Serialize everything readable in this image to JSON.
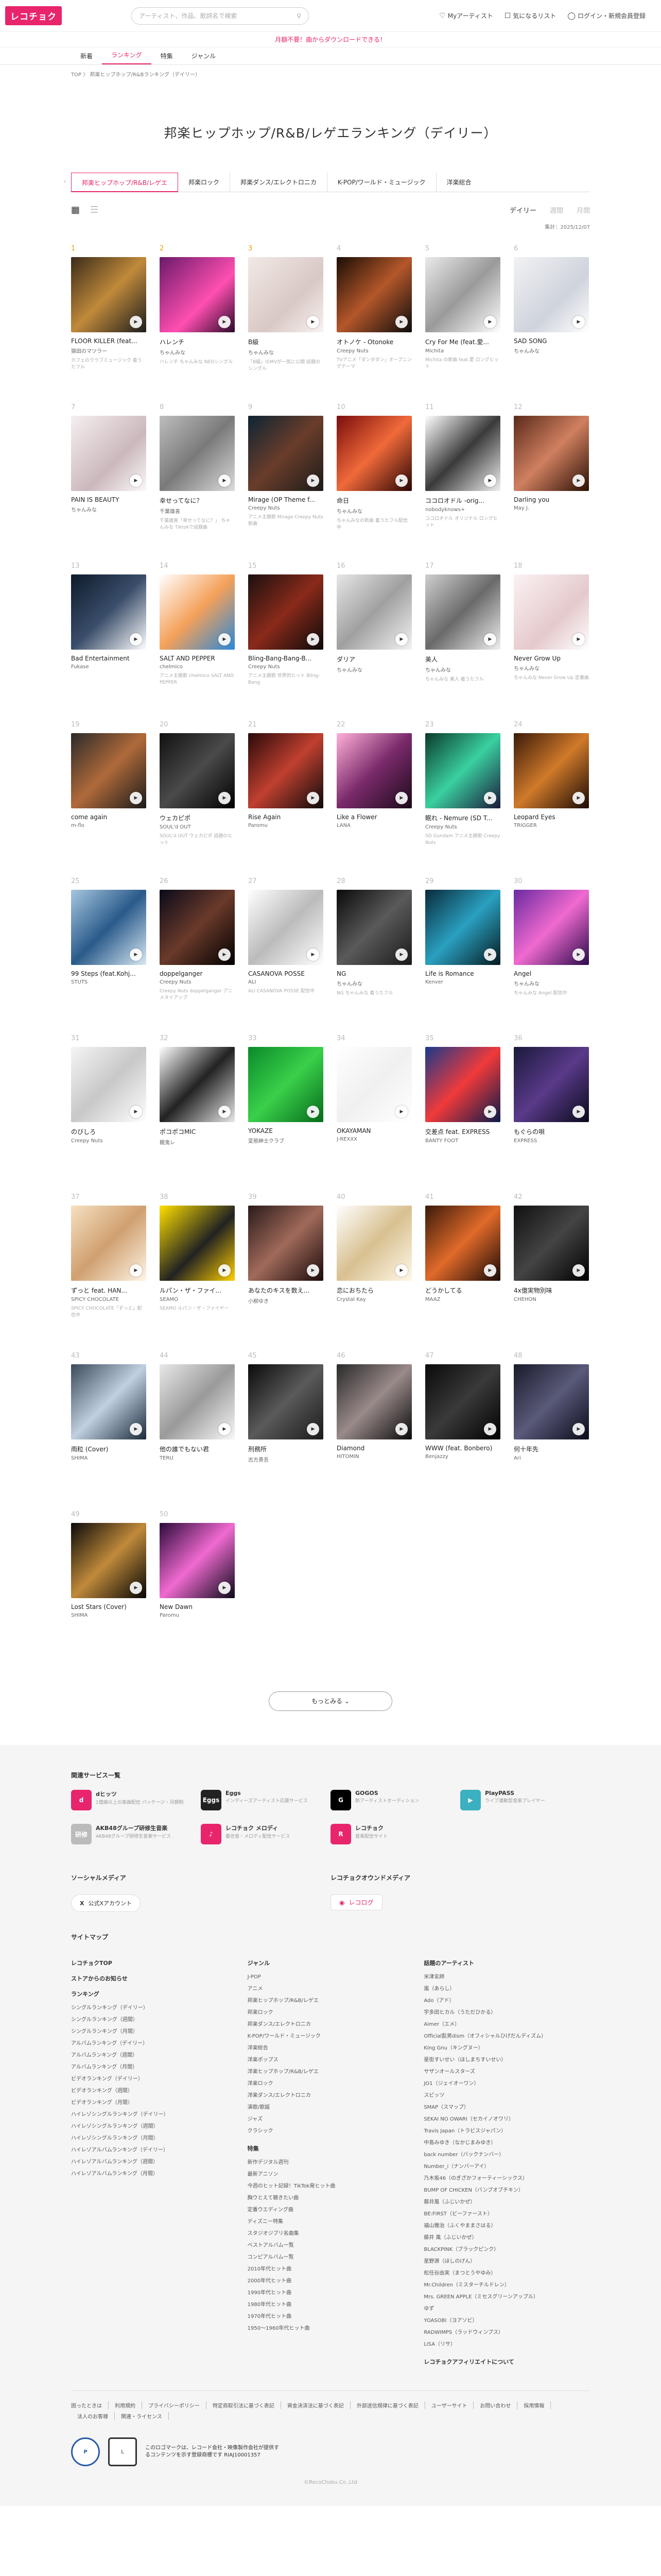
{
  "header": {
    "logo": "レコチョク",
    "search_placeholder": "アーティスト、作品、歌詞名で検索",
    "my_artist": "Myアーティスト",
    "favorites": "気になるリスト",
    "login": "ログイン・新規会員登録"
  },
  "promo": "月額不要！曲からダウンロードできる！",
  "nav": [
    "新着",
    "ランキング",
    "特集",
    "ジャンル"
  ],
  "breadcrumb": "TOP 〉 邦楽ヒップホップ/R&Bランキング（デイリー）",
  "page_title": "邦楽ヒップホップ/R&B/レゲエランキング（デイリー）",
  "tabs": [
    "邦楽ヒップホップ/R&B/レゲエ",
    "邦楽ロック",
    "邦楽ダンス/エレクトロニカ",
    "K-POP/ワールド・ミュージック",
    "洋楽総合"
  ],
  "period": {
    "daily": "デイリー",
    "weekly": "週間",
    "monthly": "月間"
  },
  "aggregation": "集計：2025/12/07",
  "items": [
    {
      "rank": "1",
      "title": "FLOOR KILLER (feat...",
      "artist": "猿田のマツラー",
      "desc": "カフェのクラブミュージック 着うたフル",
      "bg": "linear-gradient(135deg,#3a2b1a,#c08a3a 50%,#1d1d1d)"
    },
    {
      "rank": "2",
      "title": "ハレンチ",
      "artist": "ちゃんみな",
      "desc": "ハレンチ ちゃんみな  NEOシングル",
      "bg": "linear-gradient(135deg,#6a1a6a,#ff4fb0 60%,#2a0b2a)"
    },
    {
      "rank": "3",
      "title": "B級",
      "artist": "ちゃんみな",
      "desc": "「B級」のMVが一気に公開 話題のシングル",
      "bg": "linear-gradient(135deg,#f1e9e6,#d9c8c5 60%,#f8f3f1)"
    },
    {
      "rank": "4",
      "title": "オトノケ - Otonoke",
      "artist": "Creepy Nuts",
      "desc": "TVアニメ「ダンダダン」オープニングテーマ",
      "bg": "linear-gradient(135deg,#1a0d05,#b4572a 50%,#0c0c0c)"
    },
    {
      "rank": "5",
      "title": "Cry For Me (feat.愛...",
      "artist": "Michita",
      "desc": "Michita の新曲 feat.愛 ロングヒット",
      "bg": "linear-gradient(135deg,#eaeaea,#9a9a9a 50%,#ffffff)"
    },
    {
      "rank": "6",
      "title": "SAD SONG",
      "artist": "ちゃんみな",
      "desc": "",
      "bg": "linear-gradient(135deg,#f2f2f4,#cfd3dc 60%,#ffffff)"
    },
    {
      "rank": "7",
      "title": "PAIN IS BEAUTY",
      "artist": "ちゃんみな",
      "desc": "",
      "bg": "linear-gradient(135deg,#f5eff0,#cbb8bc 60%,#fbf9fa)"
    },
    {
      "rank": "8",
      "title": "幸せってなに？",
      "artist": "千葉雄喜",
      "desc": "千葉雄喜「幸せってなに？」 ちゃんみな Tiktokで話題曲",
      "bg": "linear-gradient(135deg,#bdbdbd,#7a7a7a 50%,#dcdcdc)"
    },
    {
      "rank": "9",
      "title": "Mirage (OP Theme f...",
      "artist": "Creepy Nuts",
      "desc": "アニメ主題歌 Mirage Creepy Nuts 新曲",
      "bg": "linear-gradient(135deg,#0e2433,#6a3d2a 50%,#1b1b1b)"
    },
    {
      "rank": "10",
      "title": "命日",
      "artist": "ちゃんみな",
      "desc": "ちゃんみなの新曲 着うたフル配信中",
      "bg": "linear-gradient(135deg,#7a0d0d,#f06a3a 50%,#2a0505)"
    },
    {
      "rank": "11",
      "title": "ココロオドル -orig...",
      "artist": "nobodyknows+",
      "desc": "ココロオドル オリジナル ロングヒット",
      "bg": "linear-gradient(135deg,#ffffff,#3a3a3a 50%,#f0f0f0)"
    },
    {
      "rank": "12",
      "title": "Darling you",
      "artist": "May J.",
      "desc": "",
      "bg": "linear-gradient(135deg,#5a2a1a,#d08060 50%,#2a1005)"
    },
    {
      "rank": "13",
      "title": "Bad Entertainment",
      "artist": "Fukase",
      "desc": "",
      "bg": "linear-gradient(135deg,#0d1b2a,#3a4d6a 50%,#ffffff)"
    },
    {
      "rank": "14",
      "title": "SALT AND PEPPER",
      "artist": "chelmico",
      "desc": "アニメ主題歌 chelmico SALT AND PEPPER",
      "bg": "linear-gradient(135deg,#ffffff,#f4a15a 50%,#2a88d8)"
    },
    {
      "rank": "15",
      "title": "Bling-Bang-Bang-B...",
      "artist": "Creepy Nuts",
      "desc": "アニメ主題歌 世界的ヒット Bling-Bang",
      "bg": "linear-gradient(135deg,#1a1010,#8a2a1a 50%,#0a0a0a)"
    },
    {
      "rank": "16",
      "title": "ダリア",
      "artist": "ちゃんみな",
      "desc": "",
      "bg": "linear-gradient(135deg,#e6e6e6,#a0a0a0 50%,#f3f3f3)"
    },
    {
      "rank": "17",
      "title": "美人",
      "artist": "ちゃんみな",
      "desc": "ちゃんみな 美人 着うたフル",
      "bg": "linear-gradient(135deg,#cfcfcf,#6a6a6a 50%,#efefef)"
    },
    {
      "rank": "18",
      "title": "Never Grow Up",
      "artist": "ちゃんみな",
      "desc": "ちゃんみな Never Grow Up 定番曲",
      "bg": "linear-gradient(135deg,#fbf2f3,#e4c9cc 60%,#ffffff)"
    },
    {
      "rank": "19",
      "title": "come again",
      "artist": "m-flo",
      "desc": "",
      "bg": "linear-gradient(135deg,#2a2a2a,#b06a3a 50%,#1a1a1a)"
    },
    {
      "rank": "20",
      "title": "ウェカピポ",
      "artist": "SOUL'd OUT",
      "desc": "SOUL'd OUT ウェカピポ 話題のヒット",
      "bg": "linear-gradient(135deg,#111,#4a4a4a 50%,#000)"
    },
    {
      "rank": "21",
      "title": "Rise Again",
      "artist": "Paromu",
      "desc": "",
      "bg": "linear-gradient(135deg,#2a0a0a,#c04030 50%,#0a0a0a)"
    },
    {
      "rank": "22",
      "title": "Like a Flower",
      "artist": "LANA",
      "desc": "",
      "bg": "linear-gradient(135deg,#ffb0d8,#7a2a6a 50%,#1a0a1a)"
    },
    {
      "rank": "23",
      "title": "眠れ - Nemure (SD T...",
      "artist": "Creepy Nuts",
      "desc": "SD Gundam アニメ主題歌 Creepy Nuts",
      "bg": "linear-gradient(135deg,#0a3a2a,#3ad0a0 50%,#1a1a3a)"
    },
    {
      "rank": "24",
      "title": "Leopard Eyes",
      "artist": "TRIGGER",
      "desc": "",
      "bg": "linear-gradient(135deg,#3a1a0a,#d07a2a 50%,#1a0a05)"
    },
    {
      "rank": "25",
      "title": "99 Steps (feat.Kohj...",
      "artist": "STUTS",
      "desc": "",
      "bg": "linear-gradient(135deg,#a7c7e0,#2a5a8a 50%,#d8e8f3)"
    },
    {
      "rank": "26",
      "title": "doppelganger",
      "artist": "Creepy Nuts",
      "desc": "Creepy Nuts doppelganger アニメタイアップ",
      "bg": "linear-gradient(135deg,#0a0a1a,#6a3a2a 50%,#000)"
    },
    {
      "rank": "27",
      "title": "CASANOVA POSSE",
      "artist": "ALI",
      "desc": "ALI CASANOVA POSSE 配信中",
      "bg": "linear-gradient(135deg,#ffffff,#bbbbbb 50%,#ffffff)"
    },
    {
      "rank": "28",
      "title": "NG",
      "artist": "ちゃんみな",
      "desc": "NG ちゃんみな 着うたフル",
      "bg": "linear-gradient(135deg,#0a0a0a,#5a5a5a 50%,#1a1a1a)"
    },
    {
      "rank": "29",
      "title": "Life is Romance",
      "artist": "Kenver",
      "desc": "",
      "bg": "linear-gradient(135deg,#0a2a3a,#2aa0c0 50%,#051a20)"
    },
    {
      "rank": "30",
      "title": "Angel",
      "artist": "ちゃんみな",
      "desc": "ちゃんみな Angel 配信中",
      "bg": "linear-gradient(135deg,#6a2aa0,#f06ad0 50%,#2a0a4a)"
    },
    {
      "rank": "31",
      "title": "のびしろ",
      "artist": "Creepy Nuts",
      "desc": "",
      "bg": "linear-gradient(135deg,#f5f5f5,#c8c8c8 50%,#ffffff)"
    },
    {
      "rank": "32",
      "title": "ポコポコMIC",
      "artist": "餓鬼レ",
      "desc": "",
      "bg": "linear-gradient(135deg,#ffffff,#222 50%,#e8e8e8)"
    },
    {
      "rank": "33",
      "title": "YOKAZE",
      "artist": "変態紳士クラブ",
      "desc": "",
      "bg": "linear-gradient(135deg,#0a8a2a,#3ad04a 50%,#066a1a)"
    },
    {
      "rank": "34",
      "title": "OKAYAMAN",
      "artist": "J-REXXX",
      "desc": "",
      "bg": "linear-gradient(135deg,#ffffff,#f0f0f0 50%,#ffffff)"
    },
    {
      "rank": "35",
      "title": "交差点 feat. EXPRESS",
      "artist": "BANTY FOOT",
      "desc": "",
      "bg": "linear-gradient(135deg,#1a3a8a,#f03a3a 50%,#0a1a4a)"
    },
    {
      "rank": "36",
      "title": "もぐらの唄",
      "artist": "EXPRESS",
      "desc": "",
      "bg": "linear-gradient(135deg,#1a1a3a,#5a3a8a 50%,#0a0a1a)"
    },
    {
      "rank": "37",
      "title": "ずっと feat. HAN...",
      "artist": "SPICY CHOCOLATE",
      "desc": "SPICY CHOCOLATE「ずっと」配信中",
      "bg": "linear-gradient(135deg,#f5e0c0,#d0a070 50%,#fff5e6)"
    },
    {
      "rank": "38",
      "title": "ルパン・ザ・ファイ...",
      "artist": "SEAMO",
      "desc": "SEAMO ルパン・ザ・ファイヤー",
      "bg": "linear-gradient(135deg,#ffe000,#222 55%,#ffd000)"
    },
    {
      "rank": "39",
      "title": "あなたのキスを数え...",
      "artist": "小柳ゆき",
      "desc": "",
      "bg": "linear-gradient(135deg,#2a1a1a,#a06a5a 50%,#1a0a0a)"
    },
    {
      "rank": "40",
      "title": "恋におちたら",
      "artist": "Crystal Kay",
      "desc": "",
      "bg": "linear-gradient(135deg,#ffffff,#d8c090 50%,#fff8e8)"
    },
    {
      "rank": "41",
      "title": "どうかしてる",
      "artist": "MAAZ",
      "desc": "",
      "bg": "linear-gradient(135deg,#3a1a0a,#e06a2a 50%,#1a0a05)"
    },
    {
      "rank": "42",
      "title": "4x億実物別味",
      "artist": "CHEHON",
      "desc": "",
      "bg": "linear-gradient(135deg,#111,#444 50%,#000)"
    },
    {
      "rank": "43",
      "title": "雨粒 (Cover)",
      "artist": "SHIMA",
      "desc": "",
      "bg": "linear-gradient(135deg,#3a4a5a,#c0d0e0 50%,#1a2a3a)"
    },
    {
      "rank": "44",
      "title": "他の誰でもない君",
      "artist": "TERU",
      "desc": "",
      "bg": "linear-gradient(135deg,#e8e8e8,#9a9a9a 50%,#f8f8f8)"
    },
    {
      "rank": "45",
      "title": "刑務所",
      "artist": "志方勇吾",
      "desc": "",
      "bg": "linear-gradient(135deg,#0a0a0a,#5a5a5a 50%,#1a1a1a)"
    },
    {
      "rank": "46",
      "title": "Diamond",
      "artist": "HITOMIN",
      "desc": "",
      "bg": "linear-gradient(135deg,#2a2a2a,#9a8a8a 50%,#0a0a0a)"
    },
    {
      "rank": "47",
      "title": "WWW (feat. Bonbero)",
      "artist": "Benjazzy",
      "desc": "",
      "bg": "linear-gradient(135deg,#0a0a0a,#3a3a3a 50%,#000)"
    },
    {
      "rank": "48",
      "title": "何十年先",
      "artist": "Ari",
      "desc": "",
      "bg": "linear-gradient(135deg,#1a1a2a,#5a5a7a 50%,#0a0a1a)"
    },
    {
      "rank": "49",
      "title": "Lost Stars (Cover)",
      "artist": "SHIMA",
      "desc": "",
      "bg": "linear-gradient(135deg,#0a0a0a,#c08a3a 50%,#050505)"
    },
    {
      "rank": "50",
      "title": "New Dawn",
      "artist": "Paromu",
      "desc": "",
      "bg": "linear-gradient(135deg,#2a0a3a,#f06ad0 50%,#0a0a1a)"
    }
  ],
  "more_button": "もっとみる",
  "footer": {
    "services_title": "関連サービス一覧",
    "services": [
      {
        "name": "dヒッツ",
        "desc": "1億曲以上の楽曲配信 パッケージ・月額制",
        "color": "#e8256c",
        "mark": "d"
      },
      {
        "name": "Eggs",
        "desc": "インディーズアーティスト応援サービス",
        "color": "#222222",
        "mark": "Eggs"
      },
      {
        "name": "GOGOS",
        "desc": "新アーティストオーディション",
        "color": "#000000",
        "mark": "G"
      },
      {
        "name": "PlayPASS",
        "desc": "ライブ連動型音楽プレイヤー",
        "color": "#3ab0c0",
        "mark": "▶"
      },
      {
        "name": "AKB48グループ研修生音楽",
        "desc": "AKB48グループ研修生音楽サービス",
        "color": "#bbbbbb",
        "mark": "研修"
      },
      {
        "name": "レコチョク メロディ",
        "desc": "着信音・メロディ配信サービス",
        "color": "#e8256c",
        "mark": "♪"
      },
      {
        "name": "レコチョク",
        "desc": "音楽配信サイト",
        "color": "#e8256c",
        "mark": "R"
      }
    ],
    "social_title": "ソーシャルメディア",
    "x_account": "公式Xアカウント",
    "owned_title": "レコチョクオウンドメディア",
    "owned_name": "レコログ",
    "sitemap_title": "サイトマップ",
    "col1": {
      "head1": "レコチョクTOP",
      "head2": "ストアからのお知らせ",
      "head3": "ランキング",
      "links": [
        "シングルランキング（デイリー）",
        "シングルランキング（週間）",
        "シングルランキング（月間）",
        "アルバムランキング（デイリー）",
        "アルバムランキング（週間）",
        "アルバムランキング（月間）",
        "ビデオランキング（デイリー）",
        "ビデオランキング（週間）",
        "ビデオランキング（月間）",
        "ハイレゾシングルランキング（デイリー）",
        "ハイレゾシングルランキング（週間）",
        "ハイレゾシングルランキング（月間）",
        "ハイレゾアルバムランキング（デイリー）",
        "ハイレゾアルバムランキング（週間）",
        "ハイレゾアルバムランキング（月間）"
      ]
    },
    "col2": {
      "head1": "ジャンル",
      "links1": [
        "J-POP",
        "アニメ",
        "邦楽ヒップホップ/R&B/レゲエ",
        "邦楽ロック",
        "邦楽ダンス/エレクトロニカ",
        "K-POP/ワールド・ミュージック",
        "洋楽総合",
        "洋楽ポップス",
        "洋楽ヒップホップ/R&B/レゲエ",
        "洋楽ロック",
        "洋楽ダンス/エレクトロニカ",
        "演歌/歌謡",
        "ジャズ",
        "クラシック"
      ],
      "head2": "特集",
      "links2": [
        "新作デジタル週刊",
        "最新アニソン",
        "今週のヒット記録！TikTok発ヒット曲",
        "胸ウとえて聴きたい曲",
        "定番ウエディング曲",
        "ディズニー特集",
        "スタジオジブリ名曲集",
        "ベストアルバム一覧",
        "コンピアルバム一覧",
        "2010年代ヒット曲",
        "2000年代ヒット曲",
        "1990年代ヒット曲",
        "1980年代ヒット曲",
        "1970年代ヒット曲",
        "1950〜1960年代ヒット曲"
      ]
    },
    "col3": {
      "head1": "話題のアーティスト",
      "links": [
        "米津玄師",
        "嵐（あらし）",
        "Ado（アド）",
        "宇多田ヒカル（うただひかる）",
        "Aimer（エメ）",
        "Official髭男dism（オフィシャルひげだんディズム）",
        "King Gnu（キングヌー）",
        "星街すいせい（ほしまちすいせい）",
        "サザンオールスターズ",
        "JO1（ジェイオーワン）",
        "スピッツ",
        "SMAP（スマップ）",
        "SEKAI NO OWARI（セカイノオワリ）",
        "Travis Japan（トラビスジャパン）",
        "中島みゆき（なかじまみゆき）",
        "back number（バックナンバー）",
        "Number_i（ナンバーアイ）",
        "乃木坂46（のぎざかフォーティーシックス）",
        "BUMP OF CHICKEN（バンプオブチキン）",
        "藤井風（ふじいかぜ）",
        "BE:FIRST（ビーファースト）",
        "福山雅治（ふくやままさはる）",
        "藤井 風（ふじいかぜ）",
        "BLACKPINK（ブラックピンク）",
        "星野源（ほしのげん）",
        "松任谷由実（まつとうやゆみ）",
        "Mr.Children（ミスターチルドレン）",
        "Mrs. GREEN APPLE（ミセスグリーンアップル）",
        "ゆず",
        "YOASOBI（ヨアソビ）",
        "RADWIMPS（ラッドウィンプス）",
        "LiSA（リサ）"
      ],
      "head2": "レコチョクアフィリエイトについて"
    },
    "bottom_links": [
      "困ったときは",
      "利用規約",
      "プライバシーポリシー",
      "特定商取引法に基づく表記",
      "資金決済法に基づく表記",
      "外部送信規律に基づく表記",
      "ユーザーサイト",
      "お問い合わせ",
      "採用情報",
      "法人のお客様",
      "関連・ライセンス"
    ],
    "lm_text": "このロゴマークは、レコード会社・映像製作会社が提供するコンテンツを示す登録商標です RIAJ10001357",
    "copyright": "©RecoChoku Co.,Ltd"
  }
}
